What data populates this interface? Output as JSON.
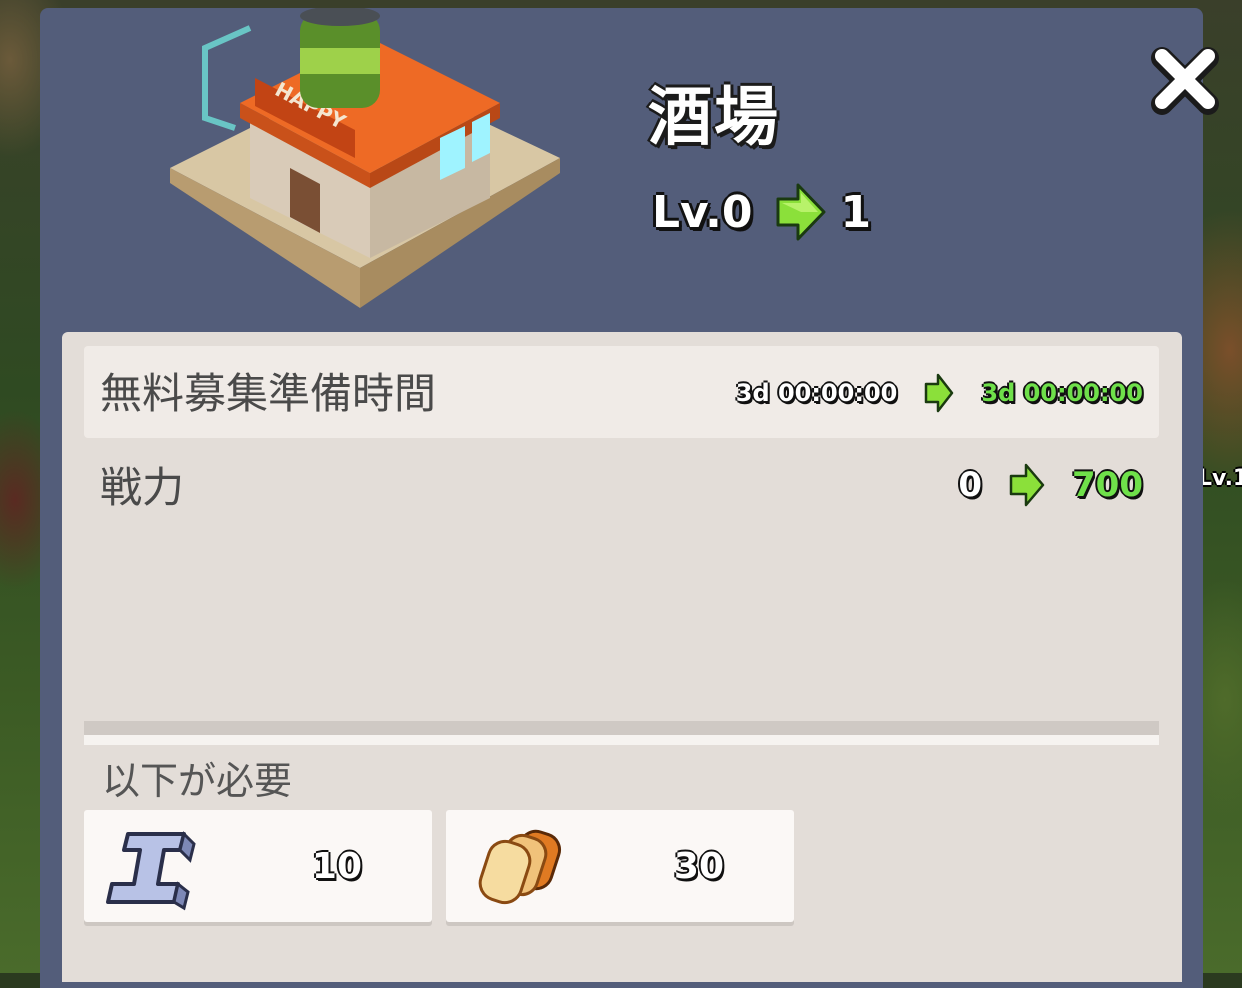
{
  "building": {
    "name": "酒場",
    "sign_text": "HAPPY",
    "level_from": "Lv.0",
    "level_to": "1"
  },
  "side_text": "Lv.1",
  "stats": [
    {
      "label": "無料募集準備時間",
      "from": "3d 00:00:00",
      "to": "3d 00:00:00"
    },
    {
      "label": "戦力",
      "from": "0",
      "to": "700"
    }
  ],
  "requirements": {
    "label": "以下が必要",
    "items": [
      {
        "icon": "iron-ingot-icon",
        "amount": "10"
      },
      {
        "icon": "bread-icon",
        "amount": "30"
      }
    ]
  },
  "colors": {
    "modal": "#535d7a",
    "panel": "#e3ddd8",
    "arrow": "#8be03a",
    "upgrade_value": "#6fe04a"
  }
}
